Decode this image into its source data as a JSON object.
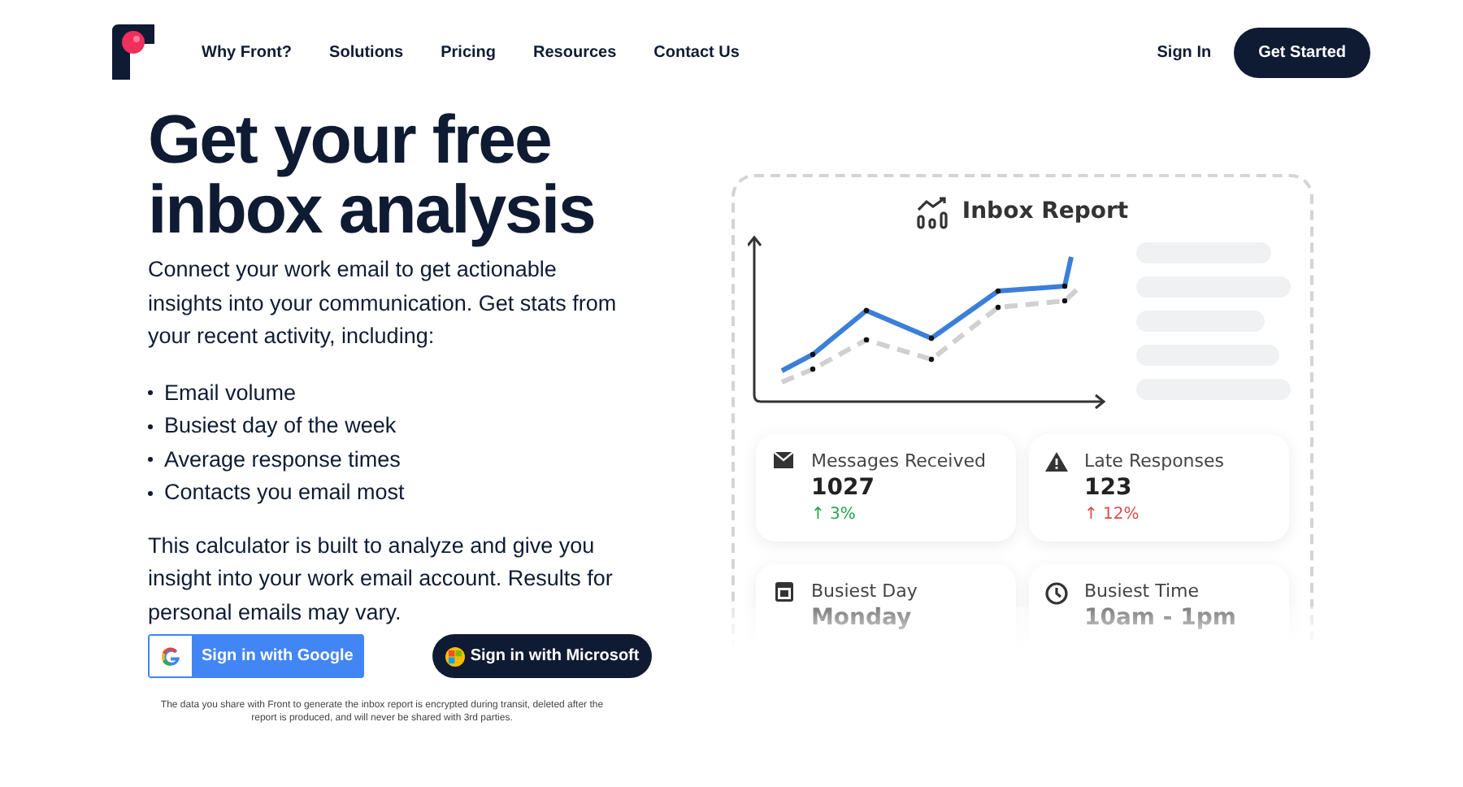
{
  "nav": {
    "links": [
      "Why Front?",
      "Solutions",
      "Pricing",
      "Resources",
      "Contact Us"
    ],
    "sign_in": "Sign In",
    "cta": "Get Started"
  },
  "hero": {
    "title": "Get your free inbox analysis",
    "intro": "Connect your work email to get actionable insights into your communication. Get stats from your recent activity, including:",
    "bullets": [
      "Email volume",
      "Busiest day of the week",
      "Average response times",
      "Contacts you email most"
    ],
    "note": "This calculator is built to analyze and give you insight into your work email account. Results for personal emails may vary.",
    "google_button": "Sign in with Google",
    "microsoft_button": "Sign in with Microsoft",
    "disclaimer": "The data you share with Front to generate the inbox report is encrypted during transit, deleted after the report is produced, and will never be shared with 3rd parties."
  },
  "report": {
    "title": "Inbox Report",
    "stats": [
      {
        "kind": "mail",
        "label": "Messages Received",
        "value": "1027",
        "change": "↑ 3%",
        "color": "#22a34a"
      },
      {
        "kind": "warning",
        "label": "Late Responses",
        "value": "123",
        "change": "↑ 12%",
        "color": "#dc4a4a"
      },
      {
        "kind": "calendar",
        "label": "Busiest Day",
        "value": "Monday"
      },
      {
        "kind": "clock",
        "label": "Busiest Time",
        "value": "10am - 1pm"
      }
    ]
  }
}
